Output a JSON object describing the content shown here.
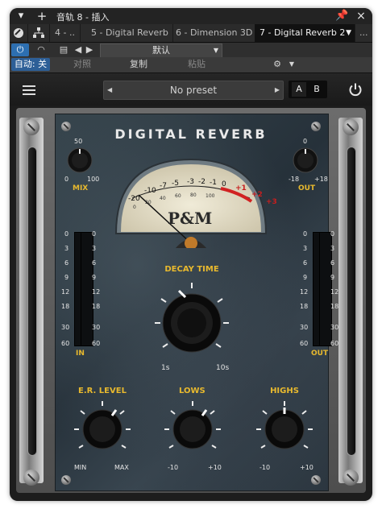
{
  "titlebar": {
    "add_icon": "+",
    "title": "音轨 8 - 插入",
    "pin_icon": "pin-icon",
    "close_icon": "×"
  },
  "tabs": [
    {
      "label": "4 - .."
    },
    {
      "label": "5 - Digital Reverb"
    },
    {
      "label": "6 - Dimension 3D"
    },
    {
      "label": "7 - Digital Reverb 2"
    }
  ],
  "tabs_more": "...",
  "toolbar": {
    "preset_default": "默认",
    "auto_label": "自动: 关",
    "compare_label": "对照",
    "copy_label": "复制",
    "paste_label": "粘贴"
  },
  "plugin_header": {
    "preset_name": "No preset",
    "a_label": "A",
    "b_label": "B"
  },
  "plugin": {
    "title": "DIGITAL REVERB",
    "brand": "P&M",
    "mix": {
      "label": "MIX",
      "min": "0",
      "mid": "50",
      "max": "100"
    },
    "out_knob": {
      "label": "OUT",
      "min": "-18",
      "mid": "0",
      "max": "+18"
    },
    "vu_scale_top": [
      "-20",
      "-10",
      "-7",
      "-5",
      "-3",
      "-2",
      "-1",
      "0",
      "+1",
      "+2",
      "+3"
    ],
    "vu_scale_bottom": [
      "0",
      "20",
      "40",
      "60",
      "80",
      "100"
    ],
    "meter_in_label": "IN",
    "meter_out_label": "OUT",
    "meter_scale": [
      "0",
      "3",
      "6",
      "9",
      "12",
      "18",
      "30",
      "60"
    ],
    "decay": {
      "label": "DECAY TIME",
      "min": "1s",
      "max": "10s"
    },
    "er_level": {
      "label": "E.R. LEVEL",
      "min": "MIN",
      "max": "MAX"
    },
    "lows": {
      "label": "LOWS",
      "min": "-10",
      "max": "+10"
    },
    "highs": {
      "label": "HIGHS",
      "min": "-10",
      "max": "+10"
    }
  }
}
